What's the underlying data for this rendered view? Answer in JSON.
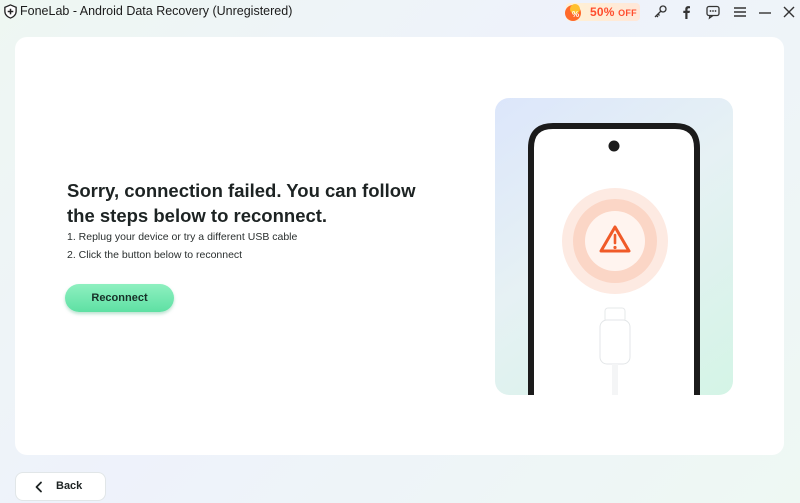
{
  "window": {
    "title": "FoneLab - Android Data Recovery (Unregistered)",
    "icons": [
      "fonelab-logo-icon",
      "key-icon",
      "facebook-icon",
      "chat-icon",
      "menu-icon",
      "minimize-icon",
      "close-icon"
    ]
  },
  "promo": {
    "discount": "50%",
    "suffix": "OFF"
  },
  "content": {
    "heading": "Sorry, connection failed. You can follow the steps below to reconnect.",
    "steps": [
      "1. Replug your device or try a different USB cable",
      "2. Click the button below to reconnect"
    ],
    "reconnect_label": "Reconnect"
  },
  "footer": {
    "back_label": "Back"
  },
  "colors": {
    "accent_green": "#5ee0a3",
    "warning_orange": "#f05a28",
    "promo_red": "#ff4d2e"
  }
}
